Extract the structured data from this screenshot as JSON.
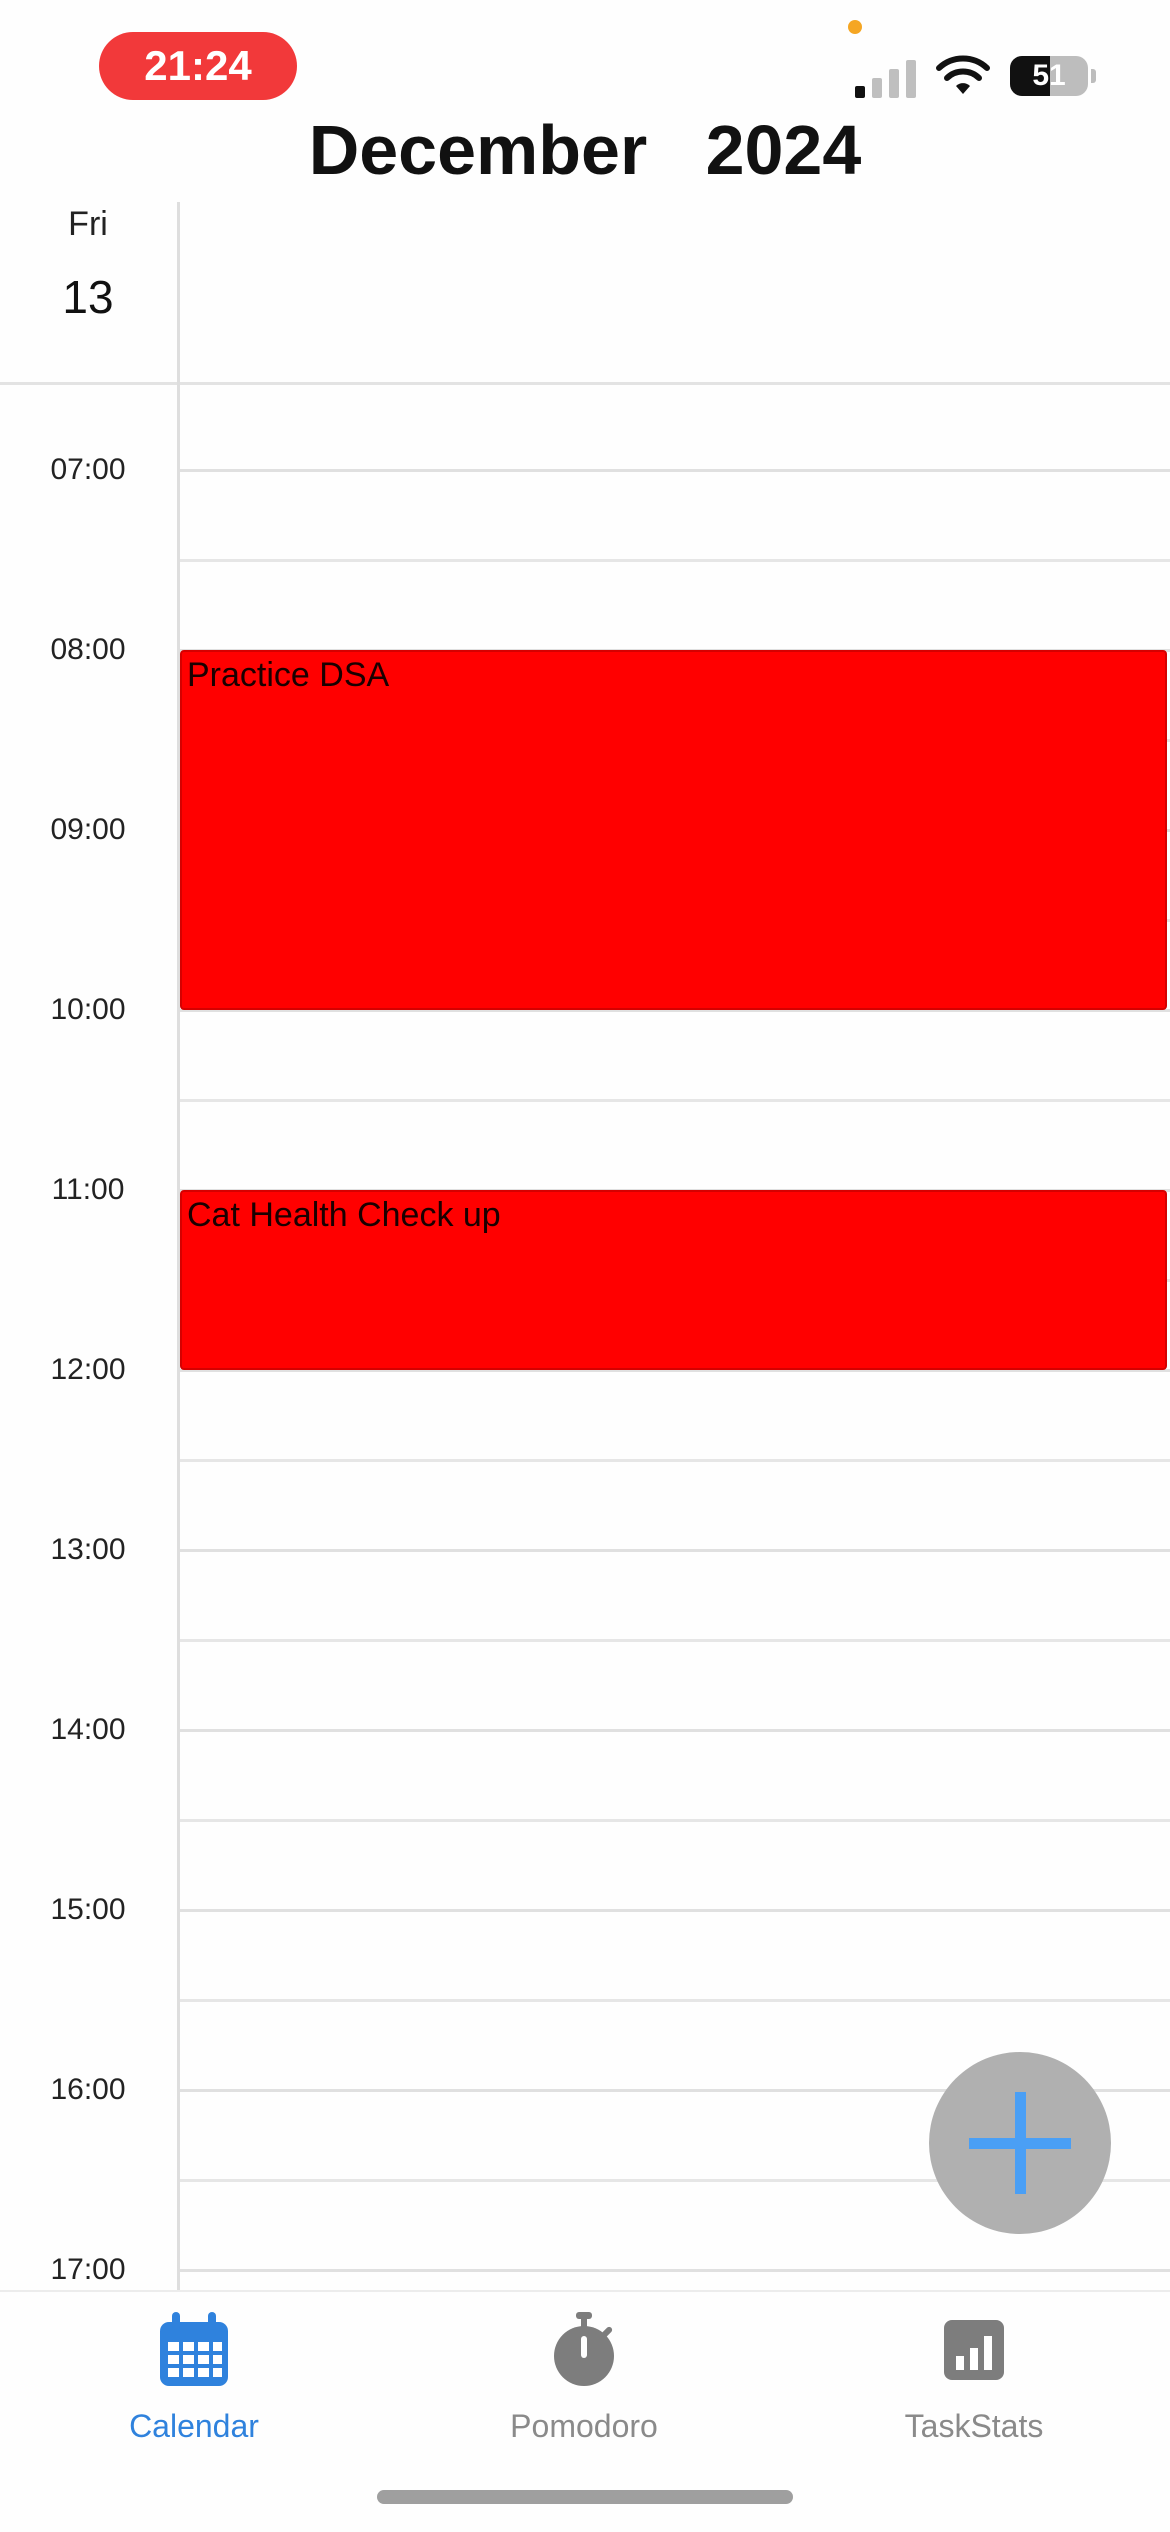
{
  "status_bar": {
    "time": "21:24",
    "battery": "51"
  },
  "header": {
    "month": "December",
    "year": "2024",
    "month_year_sep": "   "
  },
  "day": {
    "name": "Fri",
    "number": "13"
  },
  "hours": [
    "07:00",
    "08:00",
    "09:00",
    "10:00",
    "11:00",
    "12:00",
    "13:00",
    "14:00",
    "15:00",
    "16:00",
    "17:00"
  ],
  "events": [
    {
      "title": "Practice DSA",
      "start": "08:00",
      "end": "10:00",
      "color": "#ff0000"
    },
    {
      "title": "Cat Health Check up",
      "start": "11:00",
      "end": "12:00",
      "color": "#ff0000"
    }
  ],
  "fab": {
    "icon": "plus-icon"
  },
  "tabs": [
    {
      "label": "Calendar",
      "icon": "calendar-icon",
      "active": true
    },
    {
      "label": "Pomodoro",
      "icon": "stopwatch-icon",
      "active": false
    },
    {
      "label": "TaskStats",
      "icon": "bar-chart-icon",
      "active": false
    }
  ],
  "colors": {
    "accent": "#2f82dd",
    "event": "#ff0000",
    "time_pill": "#f2393a"
  }
}
